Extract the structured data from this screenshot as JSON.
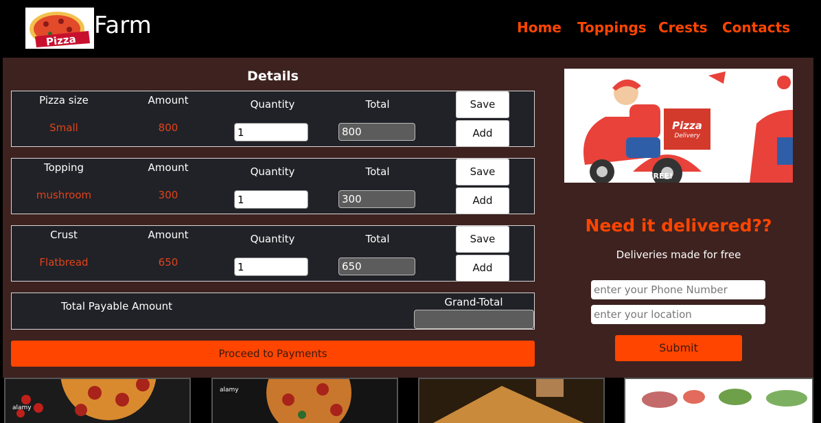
{
  "header": {
    "logo_text": "Pizza",
    "brand": "Farm",
    "nav": [
      "Home",
      "Toppings",
      "Crests",
      "Contacts"
    ]
  },
  "details": {
    "title": "Details",
    "quantity_label": "Quantity",
    "total_label": "Total",
    "save_label": "Save",
    "add_label": "Add",
    "rows": [
      {
        "label": "Pizza size",
        "amount_label": "Amount",
        "item": "Small",
        "amount": "800",
        "quantity": "1",
        "total": "800"
      },
      {
        "label": "Topping",
        "amount_label": "Amount",
        "item": "mushroom",
        "amount": "300",
        "quantity": "1",
        "total": "300"
      },
      {
        "label": "Crust",
        "amount_label": "Amount",
        "item": "Flatbread",
        "amount": "650",
        "quantity": "1",
        "total": "650"
      }
    ],
    "total_payable_label": "Total Payable Amount",
    "grand_total_label": "Grand-Total",
    "grand_total_value": "",
    "proceed_label": "Proceed to Payments"
  },
  "delivery": {
    "image_text_brand": "Pizza",
    "image_text_sub": "Delivery",
    "image_text_free": "FREE!",
    "heading": "Need it delivered??",
    "subheading": "Deliveries made for free",
    "phone_placeholder": "enter your Phone Number",
    "location_placeholder": "enter your location",
    "submit_label": "Submit"
  },
  "footer_thumbs": {
    "watermark": "alamy"
  },
  "colors": {
    "accent": "#ff4500",
    "panel": "#3d2220",
    "card": "#212227"
  }
}
